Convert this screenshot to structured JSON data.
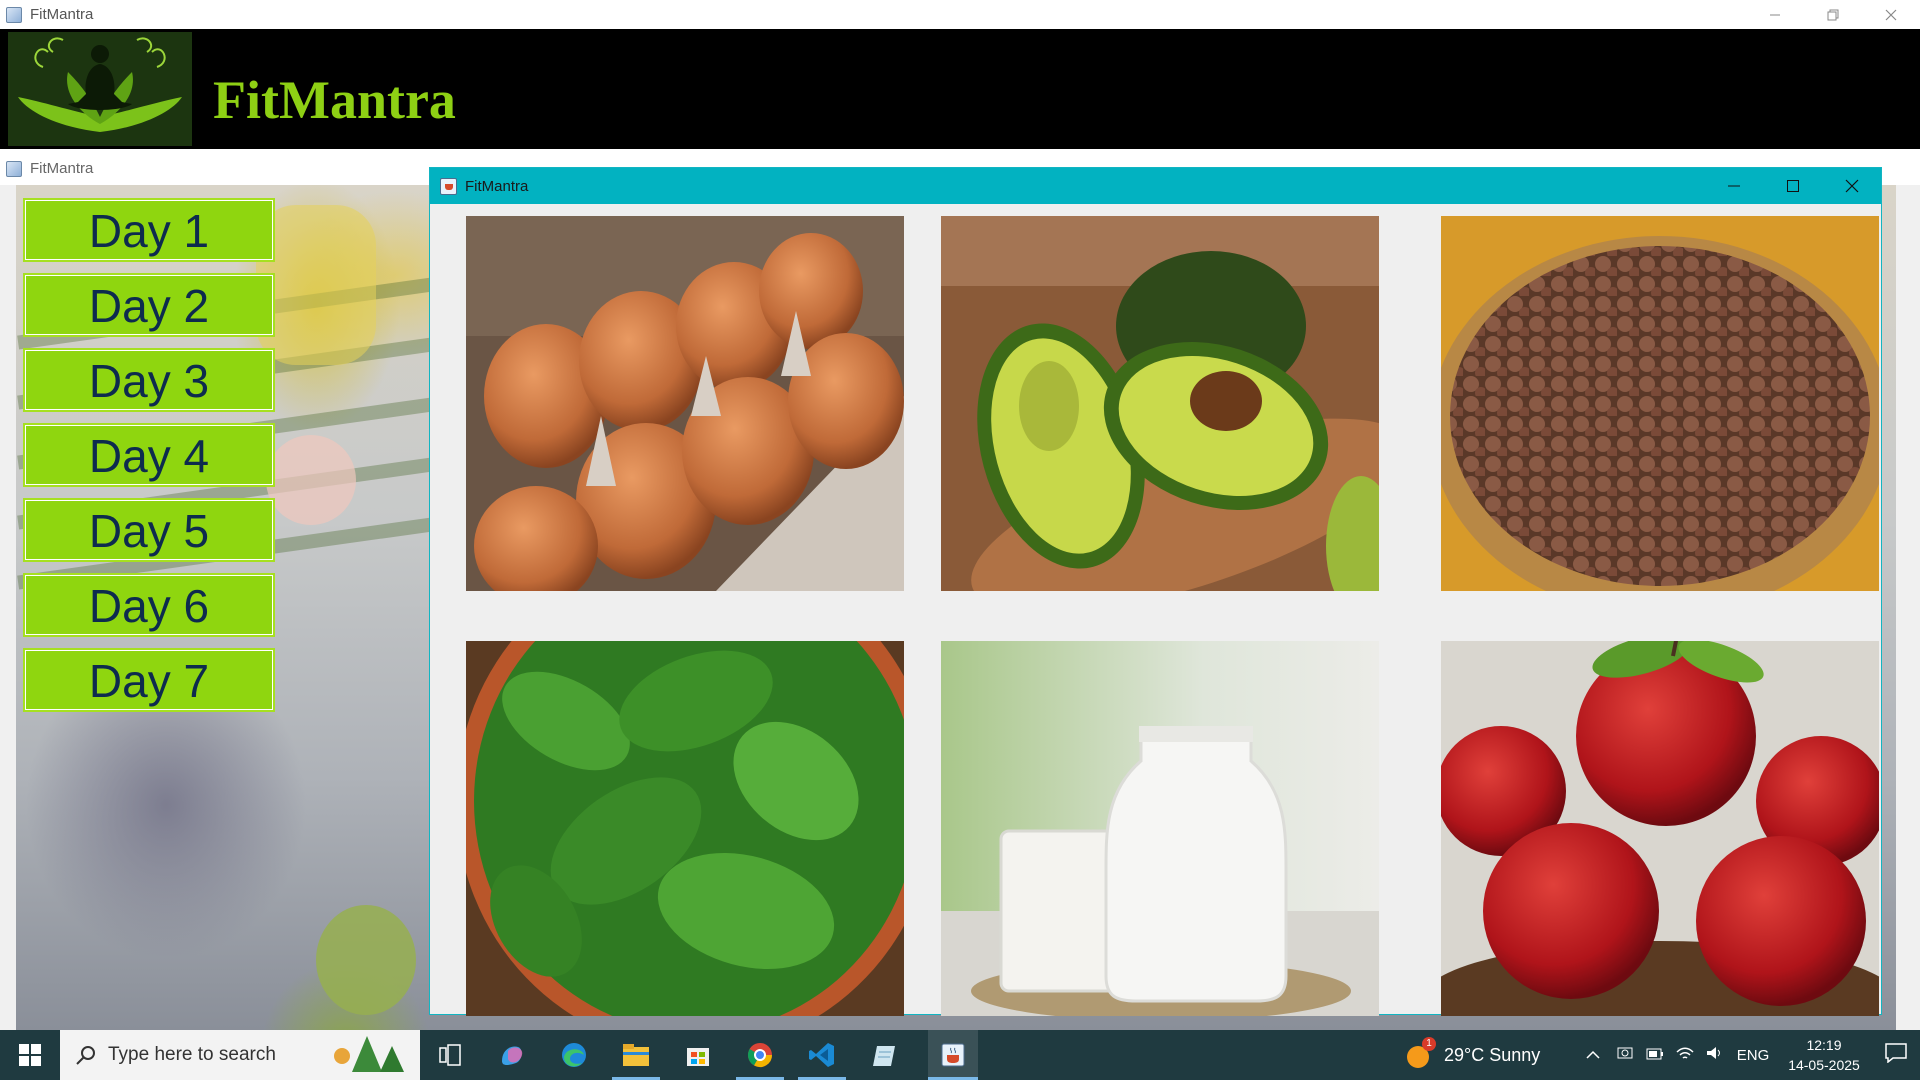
{
  "main_window": {
    "title": "FitMantra",
    "brand_title": "FitMantra"
  },
  "inner_window": {
    "title": "FitMantra"
  },
  "days": [
    "Day 1",
    "Day 2",
    "Day 3",
    "Day 4",
    "Day 5",
    "Day 6",
    "Day 7"
  ],
  "food_window": {
    "title": "FitMantra",
    "foods": [
      {
        "name": "eggs"
      },
      {
        "name": "avocado"
      },
      {
        "name": "chickpeas"
      },
      {
        "name": "spinach"
      },
      {
        "name": "milk"
      },
      {
        "name": "apples"
      }
    ]
  },
  "taskbar": {
    "search_placeholder": "Type here to search",
    "weather": "29°C Sunny",
    "language": "ENG",
    "time": "12:19",
    "date": "14-05-2025",
    "weather_badge": "1"
  },
  "colors": {
    "accent_teal": "#02b2c1",
    "day_button_green": "#8fd60f",
    "brand_green": "#8ed014",
    "taskbar": "#1f3a40"
  },
  "icons": [
    "windows-start-icon",
    "search-icon",
    "task-view-icon",
    "copilot-icon",
    "edge-icon",
    "file-explorer-icon",
    "store-icon",
    "chrome-icon",
    "vscode-icon",
    "notepad-icon",
    "java-icon",
    "weather-sun-icon",
    "chevron-up-icon",
    "camera-icon",
    "battery-icon",
    "wifi-icon",
    "volume-icon",
    "notification-icon"
  ]
}
